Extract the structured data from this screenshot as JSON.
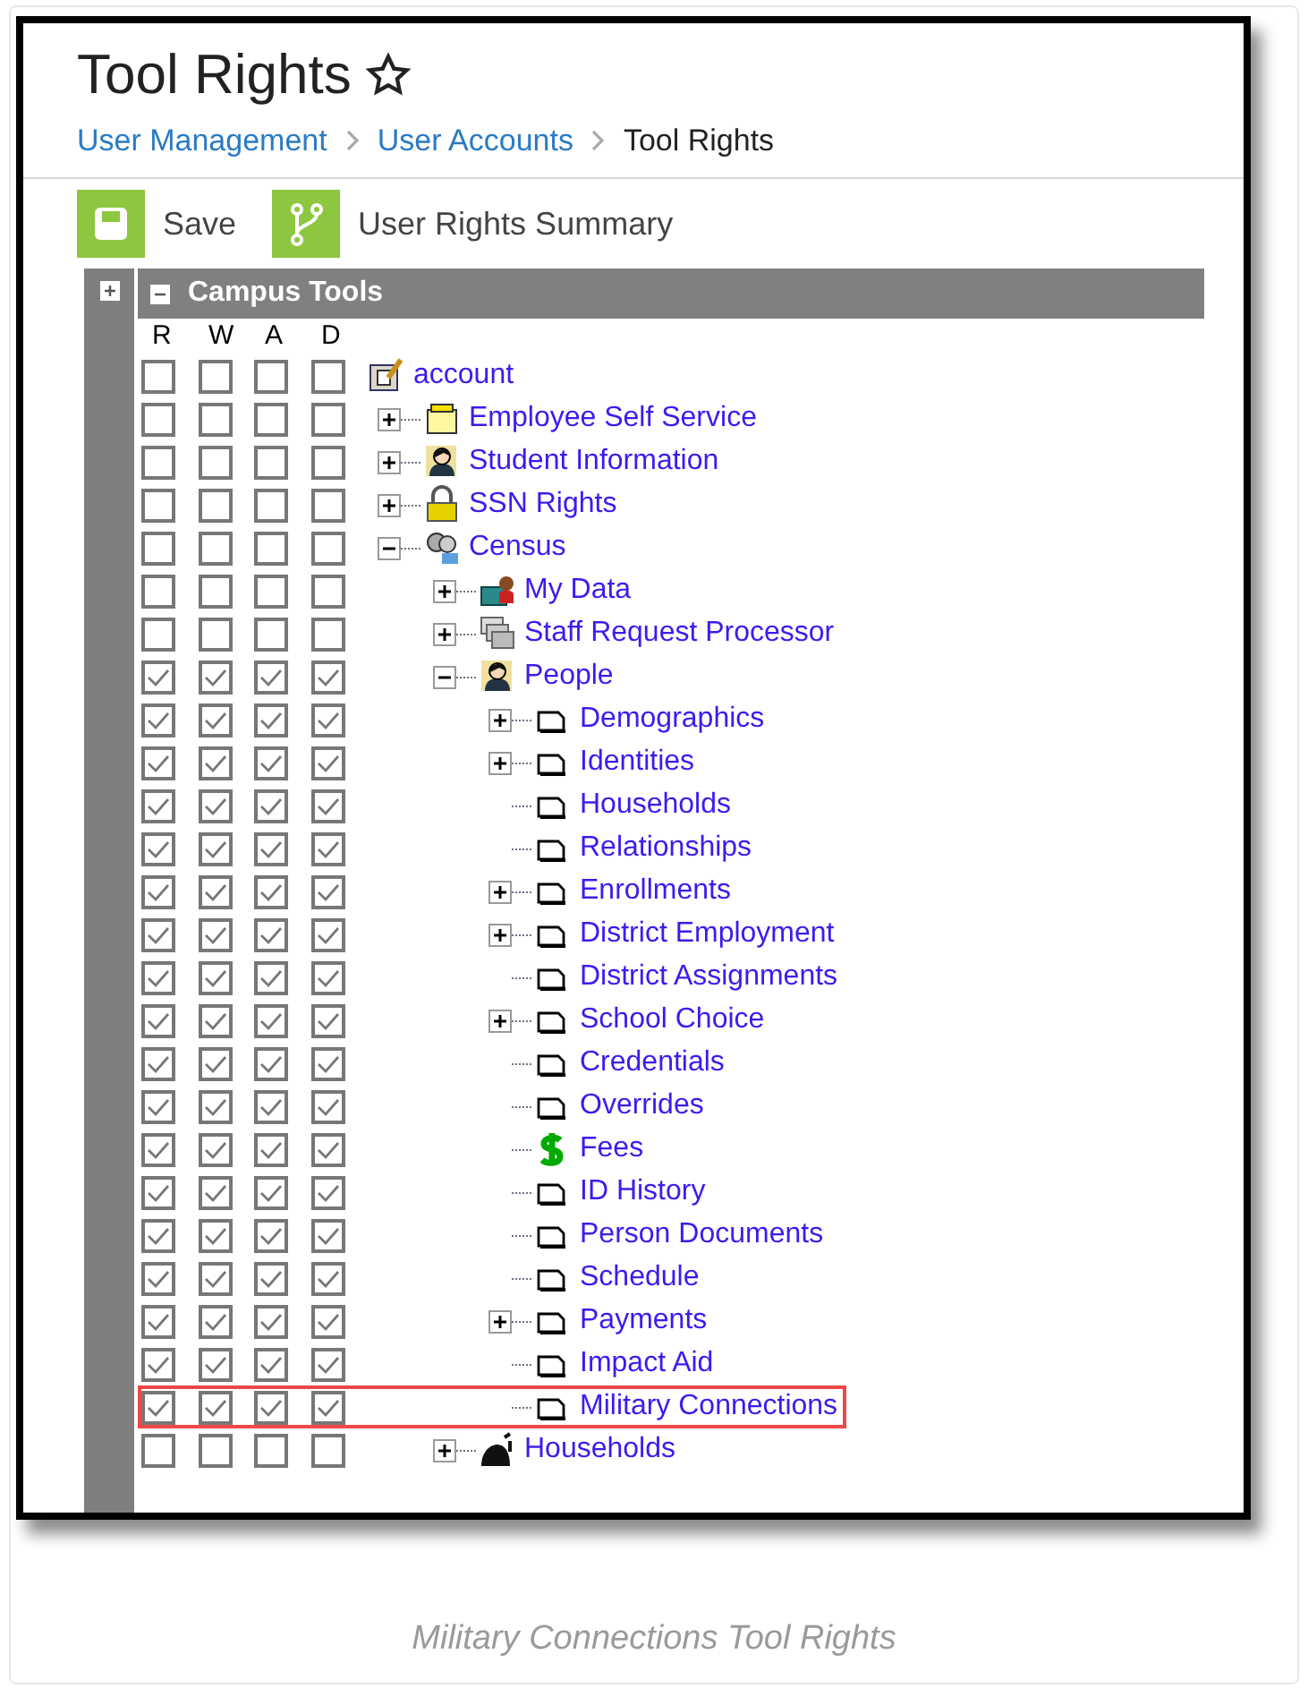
{
  "title": "Tool Rights",
  "favorite": false,
  "breadcrumb": [
    {
      "label": "User Management",
      "kind": "link"
    },
    {
      "label": "User Accounts",
      "kind": "link"
    },
    {
      "label": "Tool Rights",
      "kind": "current"
    }
  ],
  "toolbar": [
    {
      "label": "Save"
    },
    {
      "label": "User Rights Summary"
    }
  ],
  "panel": {
    "side_expanded": false,
    "expanded": true,
    "title": "Campus Tools",
    "columns": [
      "R",
      "W",
      "A",
      "D"
    ],
    "tree": [
      {
        "label": "account",
        "kind": "notepad",
        "read": false,
        "write": false,
        "add": false,
        "delete": false,
        "highlighted": false,
        "children": [
          {
            "label": "Employee Self Service",
            "kind": "folder",
            "expanded": false,
            "read": false,
            "write": false,
            "add": false,
            "delete": false,
            "highlighted": false
          },
          {
            "label": "Student Information",
            "kind": "person",
            "expanded": false,
            "read": false,
            "write": false,
            "add": false,
            "delete": false,
            "highlighted": false
          },
          {
            "label": "SSN Rights",
            "kind": "padlock",
            "expanded": false,
            "read": false,
            "write": false,
            "add": false,
            "delete": false,
            "highlighted": false
          },
          {
            "label": "Census",
            "kind": "group",
            "expanded": true,
            "read": false,
            "write": false,
            "add": false,
            "delete": false,
            "highlighted": false,
            "children": [
              {
                "label": "My Data",
                "kind": "briefcase",
                "expanded": false,
                "read": false,
                "write": false,
                "add": false,
                "delete": false,
                "highlighted": false
              },
              {
                "label": "Staff Request Processor",
                "kind": "stack",
                "expanded": false,
                "read": false,
                "write": false,
                "add": false,
                "delete": false,
                "highlighted": false
              },
              {
                "label": "People",
                "kind": "person",
                "expanded": true,
                "read": true,
                "write": true,
                "add": true,
                "delete": true,
                "highlighted": false,
                "children": [
                  {
                    "label": "Demographics",
                    "kind": "page",
                    "expanded": false,
                    "read": true,
                    "write": true,
                    "add": true,
                    "delete": true,
                    "highlighted": false
                  },
                  {
                    "label": "Identities",
                    "kind": "page",
                    "expanded": false,
                    "read": true,
                    "write": true,
                    "add": true,
                    "delete": true,
                    "highlighted": false
                  },
                  {
                    "label": "Households",
                    "kind": "page",
                    "read": true,
                    "write": true,
                    "add": true,
                    "delete": true,
                    "highlighted": false
                  },
                  {
                    "label": "Relationships",
                    "kind": "page",
                    "read": true,
                    "write": true,
                    "add": true,
                    "delete": true,
                    "highlighted": false
                  },
                  {
                    "label": "Enrollments",
                    "kind": "page",
                    "expanded": false,
                    "read": true,
                    "write": true,
                    "add": true,
                    "delete": true,
                    "highlighted": false
                  },
                  {
                    "label": "District Employment",
                    "kind": "page",
                    "expanded": false,
                    "read": true,
                    "write": true,
                    "add": true,
                    "delete": true,
                    "highlighted": false
                  },
                  {
                    "label": "District Assignments",
                    "kind": "page",
                    "read": true,
                    "write": true,
                    "add": true,
                    "delete": true,
                    "highlighted": false
                  },
                  {
                    "label": "School Choice",
                    "kind": "page",
                    "expanded": false,
                    "read": true,
                    "write": true,
                    "add": true,
                    "delete": true,
                    "highlighted": false
                  },
                  {
                    "label": "Credentials",
                    "kind": "page",
                    "read": true,
                    "write": true,
                    "add": true,
                    "delete": true,
                    "highlighted": false
                  },
                  {
                    "label": "Overrides",
                    "kind": "page",
                    "read": true,
                    "write": true,
                    "add": true,
                    "delete": true,
                    "highlighted": false
                  },
                  {
                    "label": "Fees",
                    "kind": "dollar",
                    "read": true,
                    "write": true,
                    "add": true,
                    "delete": true,
                    "highlighted": false
                  },
                  {
                    "label": "ID History",
                    "kind": "page",
                    "read": true,
                    "write": true,
                    "add": true,
                    "delete": true,
                    "highlighted": false
                  },
                  {
                    "label": "Person Documents",
                    "kind": "page",
                    "read": true,
                    "write": true,
                    "add": true,
                    "delete": true,
                    "highlighted": false
                  },
                  {
                    "label": "Schedule",
                    "kind": "page",
                    "read": true,
                    "write": true,
                    "add": true,
                    "delete": true,
                    "highlighted": false
                  },
                  {
                    "label": "Payments",
                    "kind": "page",
                    "expanded": false,
                    "read": true,
                    "write": true,
                    "add": true,
                    "delete": true,
                    "highlighted": false
                  },
                  {
                    "label": "Impact Aid",
                    "kind": "page",
                    "read": true,
                    "write": true,
                    "add": true,
                    "delete": true,
                    "highlighted": false
                  },
                  {
                    "label": "Military Connections",
                    "kind": "page",
                    "read": true,
                    "write": true,
                    "add": true,
                    "delete": true,
                    "highlighted": true
                  }
                ]
              },
              {
                "label": "Households",
                "kind": "silhouette",
                "expanded": false,
                "read": false,
                "write": false,
                "add": false,
                "delete": false,
                "highlighted": false
              }
            ]
          }
        ]
      }
    ]
  },
  "caption": "Military Connections Tool Rights"
}
